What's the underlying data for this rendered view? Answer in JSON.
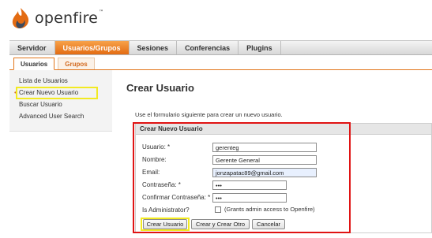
{
  "brand": {
    "name": "openfire",
    "tm": "™",
    "accent": "#e36b12"
  },
  "main_nav": [
    "Servidor",
    "Usuarios/Grupos",
    "Sesiones",
    "Conferencias",
    "Plugins"
  ],
  "sub_nav": [
    "Usuarios",
    "Grupos"
  ],
  "sidebar": {
    "items": [
      "Lista de Usuarios",
      "Crear Nuevo Usuario",
      "Buscar Usuario",
      "Advanced User Search"
    ],
    "bullet": "•"
  },
  "page": {
    "title": "Crear Usuario",
    "intro": "Use el formulario siguiente para crear un nuevo usuario."
  },
  "form": {
    "header": "Crear Nuevo Usuario",
    "fields": {
      "username": {
        "label": "Usuario: *",
        "value": "gerenteg"
      },
      "name": {
        "label": "Nombre:",
        "value": "Gerente General"
      },
      "email": {
        "label": "Email:",
        "value": "jonzapatac89@gmail.com"
      },
      "password": {
        "label": "Contraseña: *",
        "value": "•••"
      },
      "confirm": {
        "label": "Confirmar Contraseña: *",
        "value": "•••"
      },
      "admin": {
        "label": "Is Administrator?",
        "checkbox_label": "(Grants admin access to Openfire)",
        "checked": false
      }
    },
    "buttons": {
      "create": "Crear Usuario",
      "create_another": "Crear y Crear Otro",
      "cancel": "Cancelar"
    }
  }
}
